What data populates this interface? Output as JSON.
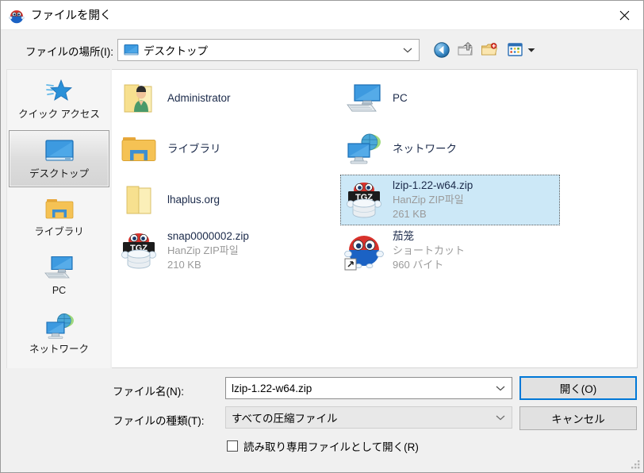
{
  "window": {
    "title": "ファイルを開く",
    "icon": "hanzip-mascot-icon",
    "close_label": "×"
  },
  "location": {
    "label": "ファイルの場所(I):",
    "value": "デスクトップ",
    "icon": "desktop-icon"
  },
  "toolbar": {
    "back": "back-navigate-icon",
    "up": "up-one-level-icon",
    "new_folder": "new-folder-icon",
    "views": "views-icon",
    "views_arrow": "chevron-down-icon"
  },
  "places": [
    {
      "label": "クイック アクセス",
      "icon": "quick-access-star-icon",
      "selected": false
    },
    {
      "label": "デスクトップ",
      "icon": "desktop-monitor-icon",
      "selected": true
    },
    {
      "label": "ライブラリ",
      "icon": "library-folder-icon",
      "selected": false
    },
    {
      "label": "PC",
      "icon": "pc-computer-icon",
      "selected": false
    },
    {
      "label": "ネットワーク",
      "icon": "network-globe-icon",
      "selected": false
    }
  ],
  "files": [
    {
      "name": "Administrator",
      "type": "",
      "size": "",
      "icon": "user-folder-icon",
      "selected": false,
      "col": 0,
      "row": 0
    },
    {
      "name": "PC",
      "type": "",
      "size": "",
      "icon": "pc-computer-icon",
      "selected": false,
      "col": 1,
      "row": 0
    },
    {
      "name": "ライブラリ",
      "type": "",
      "size": "",
      "icon": "library-folder-icon",
      "selected": false,
      "col": 0,
      "row": 1
    },
    {
      "name": "ネットワーク",
      "type": "",
      "size": "",
      "icon": "network-globe-icon",
      "selected": false,
      "col": 1,
      "row": 1
    },
    {
      "name": "lhaplus.org",
      "type": "",
      "size": "",
      "icon": "folder-icon",
      "selected": false,
      "col": 0,
      "row": 2
    },
    {
      "name": "lzip-1.22-w64.zip",
      "type": "HanZip ZIP파일",
      "size": "261 KB",
      "icon": "tgz-archive-icon",
      "selected": true,
      "col": 1,
      "row": 2
    },
    {
      "name": "snap0000002.zip",
      "type": "HanZip ZIP파일",
      "size": "210 KB",
      "icon": "tgz-archive-icon",
      "selected": false,
      "col": 0,
      "row": 3
    },
    {
      "name": "茄笼",
      "type": "ショートカット",
      "size": "960 バイト",
      "icon": "hanzip-shortcut-icon",
      "selected": false,
      "col": 1,
      "row": 3
    }
  ],
  "form": {
    "filename_label": "ファイル名(N):",
    "filename_value": "lzip-1.22-w64.zip",
    "filetype_label": "ファイルの種類(T):",
    "filetype_value": "すべての圧縮ファイル",
    "readonly_label": "読み取り専用ファイルとして開く(R)",
    "readonly_checked": false
  },
  "buttons": {
    "open": "開く(O)",
    "cancel": "キャンセル"
  },
  "colors": {
    "selection": "#cce8f7",
    "focus_border": "#0078d7",
    "meta_text": "#9a9a9a",
    "filename_text": "#1b2a4a"
  }
}
